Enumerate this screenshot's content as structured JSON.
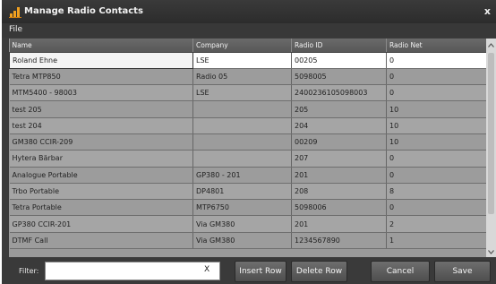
{
  "window": {
    "title": "Manage Radio Contacts",
    "close_label": "x",
    "icon": "bar-chart-icon"
  },
  "menu": {
    "file_label": "File"
  },
  "grid": {
    "columns": [
      "Name",
      "Company",
      "Radio ID",
      "Radio Net"
    ],
    "rows": [
      [
        "Roland Ehne",
        "LSE",
        "00205",
        "0"
      ],
      [
        "Tetra MTP850",
        "Radio 05",
        "5098005",
        "0"
      ],
      [
        "MTM5400 - 98003",
        "LSE",
        "2400236105098003",
        "0"
      ],
      [
        "test 205",
        "",
        "205",
        "10"
      ],
      [
        "test 204",
        "",
        "204",
        "10"
      ],
      [
        "GM380 CCIR-209",
        "",
        "00209",
        "10"
      ],
      [
        "Hytera Bärbar",
        "",
        "207",
        "0"
      ],
      [
        "Analogue Portable",
        "GP380 - 201",
        "201",
        "0"
      ],
      [
        "Trbo Portable",
        "DP4801",
        "208",
        "8"
      ],
      [
        "Tetra Portable",
        "MTP6750",
        "5098006",
        "0"
      ],
      [
        "GP380 CCIR-201",
        "Via GM380",
        "201",
        "2"
      ],
      [
        "DTMF Call",
        "Via GM380",
        "1234567890",
        "1"
      ]
    ]
  },
  "scrollbar": {
    "up_icon": "chevron-up-icon",
    "down_icon": "chevron-down-icon"
  },
  "footer": {
    "filter_label": "Filter:",
    "filter_value": "",
    "filter_clear": "X",
    "insert_row": "Insert Row",
    "delete_row": "Delete Row",
    "cancel": "Cancel",
    "save": "Save"
  }
}
